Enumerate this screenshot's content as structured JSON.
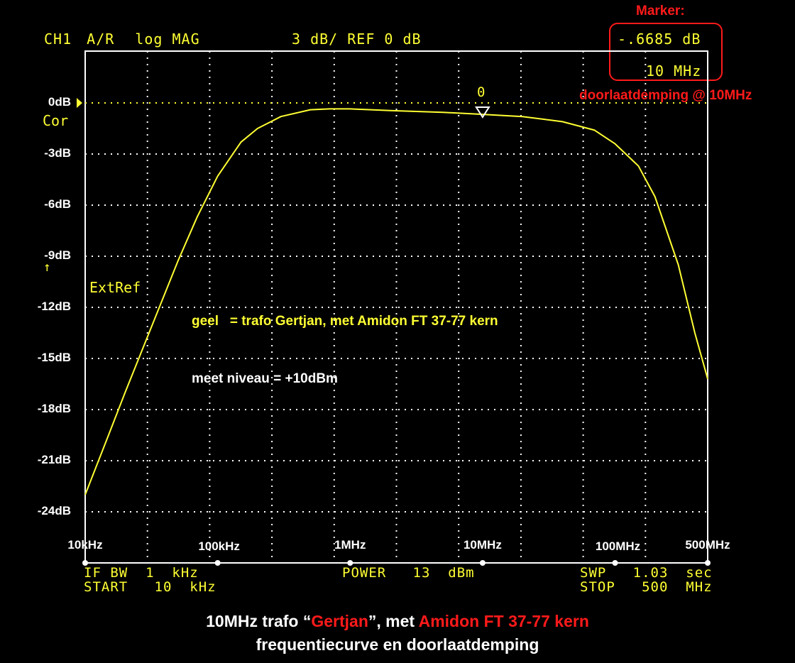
{
  "header": {
    "channel": "CH1",
    "ratio": "A/R",
    "format": "log MAG",
    "scale": "3 dB/",
    "reference": "REF 0 dB"
  },
  "marker_box": {
    "title": "Marker:",
    "value": "-.6685 dB",
    "freq": "10 MHz",
    "note": "doorlaatdemping @ 10MHz"
  },
  "status": {
    "cor": "Cor",
    "extref": "ExtRef",
    "marker_number": "0"
  },
  "legend": {
    "trace": "geel   = trafo Gertjan, met Amidon FT 37-77 kern",
    "level": "meet niveau = +10dBm"
  },
  "footer": {
    "ifbw": "IF BW  1  kHz",
    "start": "START   10  kHz",
    "power": "POWER   13  dBm",
    "sweep": "SWP   1.03  sec",
    "stop": "STOP   500  MHz"
  },
  "caption": {
    "line1_a": "10MHz trafo “",
    "line1_b": "Gertjan",
    "line1_c": "”, met ",
    "line1_d": "Amidon FT 37-77 kern",
    "line2": "frequentiecurve en doorlaatdemping"
  },
  "colors": {
    "trace": "#ffff33",
    "grid": "#ffffff",
    "annotation": "#ff1a1a"
  },
  "chart_data": {
    "type": "line",
    "x_scale": "log",
    "xlim": [
      10000,
      500000000
    ],
    "ylim": [
      -24,
      0
    ],
    "grid": true,
    "x_tick_labels": [
      "10kHz",
      "100kHz",
      "1MHz",
      "10MHz",
      "100MHz",
      "500MHz"
    ],
    "y_tick_labels": [
      "0dB",
      "-3dB",
      "-6dB",
      "-9dB",
      "-12dB",
      "-15dB",
      "-18dB",
      "-21dB",
      "-24dB"
    ],
    "series": [
      {
        "name": "geel = trafo Gertjan, met Amidon FT 37-77 kern",
        "x_hz": [
          10000,
          15000,
          20000,
          30000,
          50000,
          70000,
          100000,
          150000,
          200000,
          300000,
          500000,
          700000,
          1000000,
          2000000,
          5000000,
          10000000,
          20000000,
          40000000,
          70000000,
          100000000,
          150000000,
          200000000,
          300000000,
          400000000,
          500000000
        ],
        "y_db": [
          -23.0,
          -19.5,
          -17.0,
          -13.6,
          -9.3,
          -6.7,
          -4.3,
          -2.3,
          -1.5,
          -0.8,
          -0.4,
          -0.35,
          -0.35,
          -0.45,
          -0.55,
          -0.67,
          -0.8,
          -1.1,
          -1.6,
          -2.4,
          -3.7,
          -5.5,
          -9.5,
          -13.5,
          -16.2
        ]
      }
    ],
    "marker": {
      "x_hz": 10000000,
      "y_db": -0.6685,
      "label": "0"
    }
  }
}
